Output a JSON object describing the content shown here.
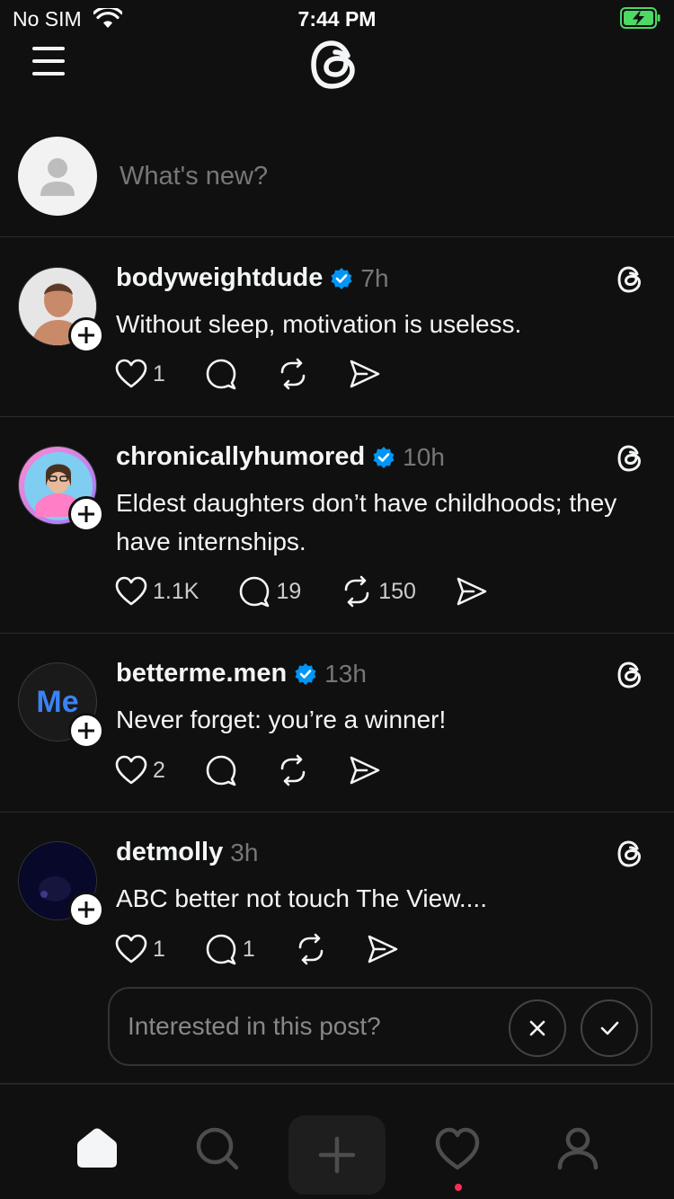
{
  "status_bar": {
    "carrier": "No SIM",
    "time": "7:44 PM"
  },
  "composer": {
    "placeholder": "What's new?"
  },
  "posts": [
    {
      "username": "bodyweightdude",
      "verified": true,
      "ago": "7h",
      "text": "Without sleep, motivation is useless.",
      "likes": "1",
      "replies": "",
      "reposts": ""
    },
    {
      "username": "chronicallyhumored",
      "verified": true,
      "ago": "10h",
      "text": "Eldest daughters don’t have childhoods; they have internships.",
      "likes": "1.1K",
      "replies": "19",
      "reposts": "150"
    },
    {
      "username": "betterme.men",
      "verified": true,
      "ago": "13h",
      "text": "Never forget: you’re a winner!",
      "likes": "2",
      "replies": "",
      "reposts": "",
      "avatar_text": "Me"
    },
    {
      "username": "detmolly",
      "verified": false,
      "ago": "3h",
      "text": "ABC better not touch The View....",
      "likes": "1",
      "replies": "1",
      "reposts": ""
    }
  ],
  "prompt": {
    "question": "Interested in this post?"
  },
  "colors": {
    "background": "#101010",
    "verified": "#0095f6",
    "muted": "#777777",
    "notification_dot": "#ff2d55"
  },
  "icons": [
    "menu-icon",
    "threads-logo-icon",
    "heart-icon",
    "comment-icon",
    "repost-icon",
    "share-icon",
    "close-icon",
    "check-icon",
    "home-icon",
    "search-icon",
    "plus-icon",
    "profile-icon"
  ]
}
